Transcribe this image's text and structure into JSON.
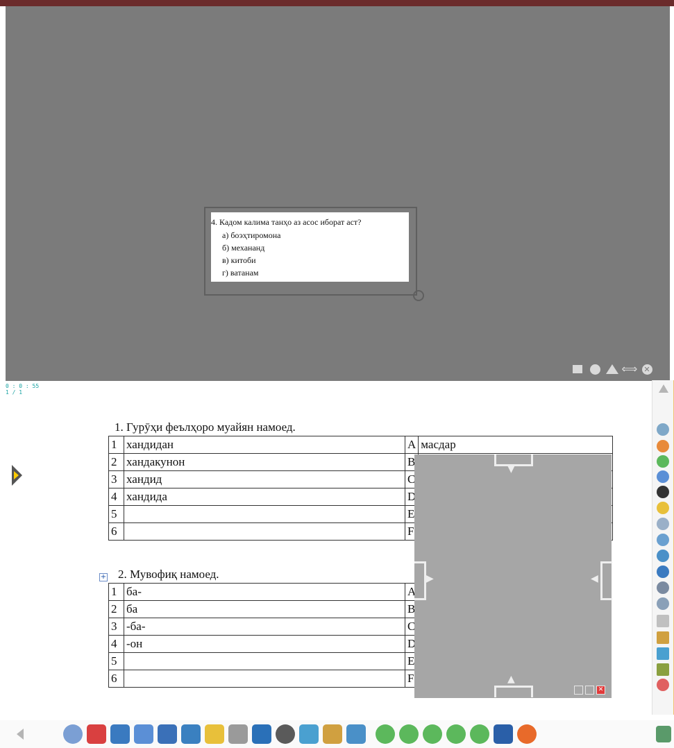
{
  "spotlight": {
    "question": "4. Кадом калима танҳо аз асос иборат аст?",
    "options": [
      "а) боэҳтиромона",
      "б) механанд",
      "в) китоби",
      "г) ватанам"
    ],
    "tools": [
      "rectangle-shape-icon",
      "circle-shape-icon",
      "triangle-shape-icon",
      "diamond-shape-icon",
      "close-icon"
    ]
  },
  "status": {
    "timer": "0 : 0 : 55",
    "page": "1 / 1"
  },
  "exercise1": {
    "title": "1. Гурӯҳи феълҳоро муайян намоед.",
    "rows": [
      {
        "num": "1",
        "word": "хандидан",
        "letter": "A",
        "answer": "масдар"
      },
      {
        "num": "2",
        "word": "хандакунон",
        "letter": "B",
        "answer": ""
      },
      {
        "num": "3",
        "word": "хандид",
        "letter": "C",
        "answer": ""
      },
      {
        "num": "4",
        "word": "хандида",
        "letter": "D",
        "answer": ""
      },
      {
        "num": "5",
        "word": "",
        "letter": "E",
        "answer": ""
      },
      {
        "num": "6",
        "word": "",
        "letter": "F",
        "answer": ""
      }
    ]
  },
  "exercise2": {
    "title": "2. Мувофиқ намоед.",
    "rows": [
      {
        "num": "1",
        "word": "ба-",
        "letter": "A"
      },
      {
        "num": "2",
        "word": "ба",
        "letter": "B"
      },
      {
        "num": "3",
        "word": "-ба-",
        "letter": "C"
      },
      {
        "num": "4",
        "word": "-он",
        "letter": "D"
      },
      {
        "num": "5",
        "word": "",
        "letter": "E"
      },
      {
        "num": "6",
        "word": "",
        "letter": "F"
      }
    ]
  },
  "colors": {
    "spotlight_bg": "#7b7b7b",
    "screen_shade": "#a6a6a6",
    "timer_text": "#1aa3a3",
    "topbar": "#6b2b2b"
  }
}
